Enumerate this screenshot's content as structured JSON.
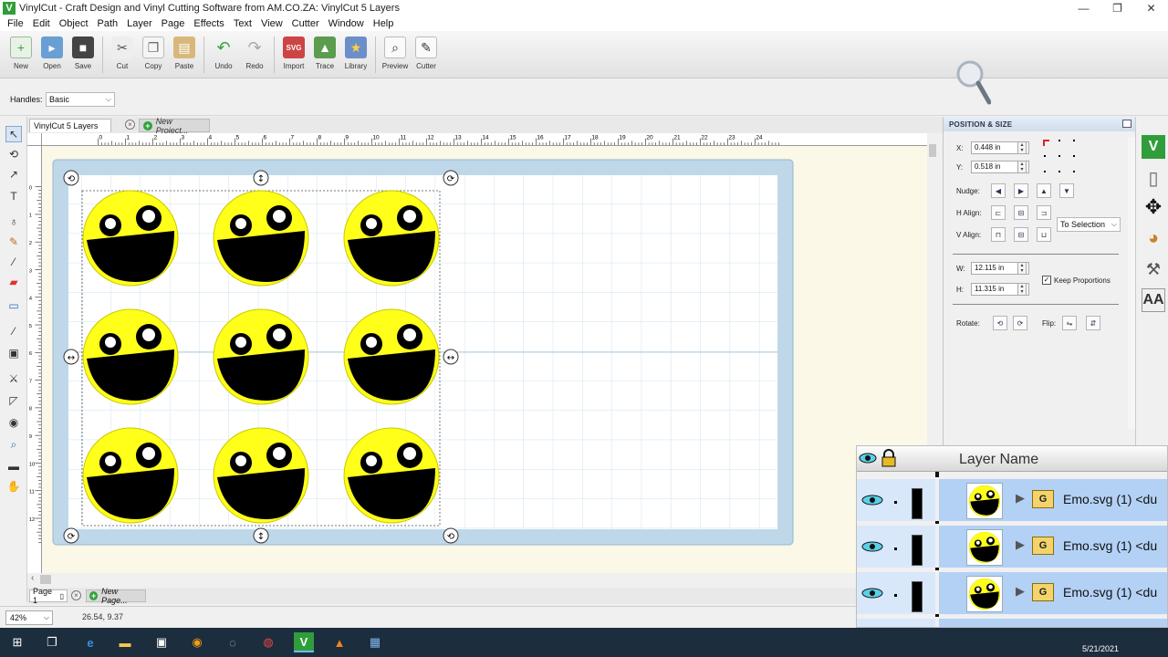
{
  "window": {
    "title": "VinylCut - Craft Design and Vinyl Cutting Software from AM.CO.ZA: VinylCut 5 Layers",
    "app_icon": "V",
    "min": "—",
    "max": "❐",
    "close": "✕"
  },
  "menu": [
    "File",
    "Edit",
    "Object",
    "Path",
    "Layer",
    "Page",
    "Effects",
    "Text",
    "View",
    "Cutter",
    "Window",
    "Help"
  ],
  "toolbar": {
    "new": "New",
    "open": "Open",
    "save": "Save",
    "cut": "Cut",
    "copy": "Copy",
    "paste": "Paste",
    "undo": "Undo",
    "redo": "Redo",
    "import": "Import",
    "trace": "Trace",
    "library": "Library",
    "preview": "Preview",
    "cutter": "Cutter"
  },
  "handles": {
    "label": "Handles:",
    "value": "Basic"
  },
  "doc_tabs": {
    "active": "VinylCut 5 Layers",
    "new": "New Project..."
  },
  "ruler": {
    "h": [
      "0",
      "1",
      "2",
      "3",
      "4",
      "5",
      "6",
      "7",
      "8",
      "9",
      "10",
      "11",
      "12",
      "13",
      "14",
      "15",
      "16",
      "17",
      "18",
      "19",
      "20",
      "21",
      "22",
      "23",
      "24"
    ],
    "v": [
      "0",
      "1",
      "2",
      "3",
      "4",
      "5",
      "6",
      "7",
      "8",
      "9",
      "10",
      "11",
      "12"
    ]
  },
  "page_tabs": {
    "active": "Page 1",
    "new": "New Page..."
  },
  "status": {
    "zoom": "42%",
    "coords": "26.54, 9.37"
  },
  "position_size": {
    "header": "POSITION & SIZE",
    "x_label": "X:",
    "x_value": "0.448 in",
    "y_label": "Y:",
    "y_value": "0.518 in",
    "nudge_label": "Nudge:",
    "halign_label": "H Align:",
    "valign_label": "V Align:",
    "align_to": "To Selection",
    "w_label": "W:",
    "w_value": "12.115 in",
    "h_label": "H:",
    "h_value": "11.315 in",
    "keep_proportions": "Keep Proportions",
    "rotate_label": "Rotate:",
    "flip_label": "Flip:"
  },
  "layers": {
    "header": "Layer Name",
    "rows": [
      {
        "name": "Emo.svg (1) <du",
        "group": "G"
      },
      {
        "name": "Emo.svg (1) <du",
        "group": "G"
      },
      {
        "name": "Emo.svg (1) <du",
        "group": "G"
      }
    ]
  },
  "taskbar": {
    "clock": "5/21/2021"
  },
  "colors": {
    "emoji": "#ffff1a",
    "mat": "#bed8ea",
    "grid": "#cfe3ef",
    "layer_row": "#b3d1f5"
  }
}
